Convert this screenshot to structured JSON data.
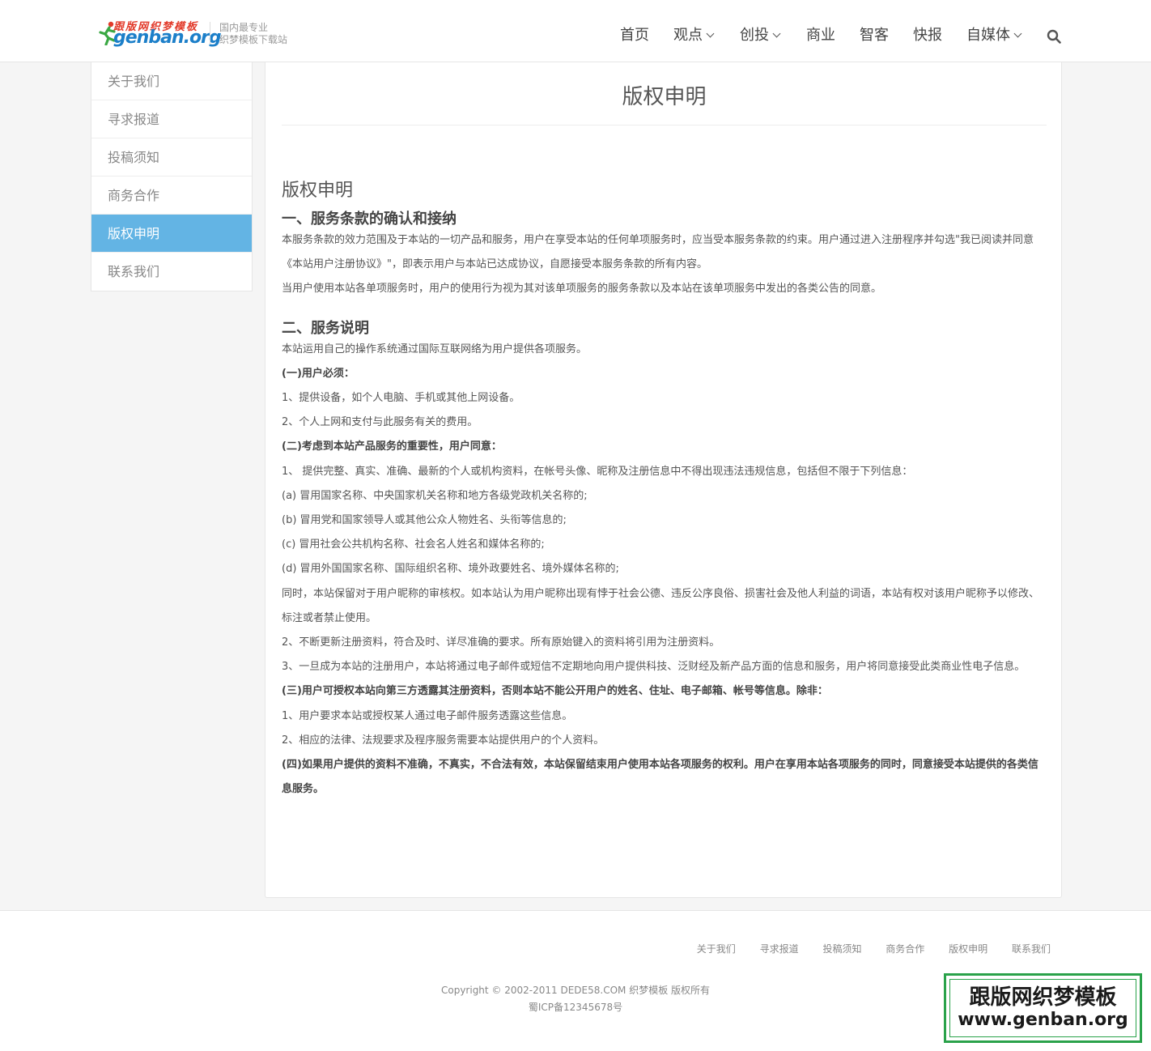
{
  "header": {
    "logo_top": "跟版网织梦模板",
    "logo_main": "genban.org",
    "slogan_line1": "国内最专业",
    "slogan_line2": "织梦模板下载站",
    "nav": [
      {
        "label": "首页",
        "dropdown": false
      },
      {
        "label": "观点",
        "dropdown": true
      },
      {
        "label": "创投",
        "dropdown": true
      },
      {
        "label": "商业",
        "dropdown": false
      },
      {
        "label": "智客",
        "dropdown": false
      },
      {
        "label": "快报",
        "dropdown": false
      },
      {
        "label": "自媒体",
        "dropdown": true
      }
    ]
  },
  "sidebar": {
    "items": [
      {
        "label": "关于我们"
      },
      {
        "label": "寻求报道"
      },
      {
        "label": "投稿须知"
      },
      {
        "label": "商务合作"
      },
      {
        "label": "版权申明"
      },
      {
        "label": "联系我们"
      }
    ],
    "active_index": 4,
    "active_color": "#63b4e4"
  },
  "article": {
    "title": "版权申明",
    "heading": "版权申明",
    "section1_title": "一、服务条款的确认和接纳",
    "section1_p1": "本服务条款的效力范围及于本站的一切产品和服务，用户在享受本站的任何单项服务时，应当受本服务条款的约束。用户通过进入注册程序并勾选\"我已阅读并同意《本站用户注册协议》\"，即表示用户与本站已达成协议，自愿接受本服务条款的所有内容。",
    "section1_p2": "当用户使用本站各单项服务时，用户的使用行为视为其对该单项服务的服务条款以及本站在该单项服务中发出的各类公告的同意。",
    "section2_title": "二、服务说明",
    "section2_intro": "本站运用自己的操作系统通过国际互联网络为用户提供各项服务。",
    "sub1_title": "(一)用户必须：",
    "sub1_p1": "1、提供设备，如个人电脑、手机或其他上网设备。",
    "sub1_p2": "2、个人上网和支付与此服务有关的费用。",
    "sub2_title": "(二)考虑到本站产品服务的重要性，用户同意：",
    "sub2_p1": "1、 提供完整、真实、准确、最新的个人或机构资料，在帐号头像、昵称及注册信息中不得出现违法违规信息，包括但不限于下列信息：",
    "sub2_a": "(a) 冒用国家名称、中央国家机关名称和地方各级党政机关名称的;",
    "sub2_b": "(b) 冒用党和国家领导人或其他公众人物姓名、头衔等信息的;",
    "sub2_c": "(c) 冒用社会公共机构名称、社会名人姓名和媒体名称的;",
    "sub2_d": "(d) 冒用外国国家名称、国际组织名称、境外政要姓名、境外媒体名称的;",
    "sub2_p2": "同时，本站保留对于用户昵称的审核权。如本站认为用户昵称出现有悖于社会公德、违反公序良俗、损害社会及他人利益的词语，本站有权对该用户昵称予以修改、标注或者禁止使用。",
    "sub2_p3": "2、不断更新注册资料，符合及时、详尽准确的要求。所有原始键入的资料将引用为注册资料。",
    "sub2_p4": "3、一旦成为本站的注册用户，本站将通过电子邮件或短信不定期地向用户提供科技、泛财经及新产品方面的信息和服务，用户将同意接受此类商业性电子信息。",
    "sub3_title": "(三)用户可授权本站向第三方透露其注册资料，否则本站不能公开用户的姓名、住址、电子邮箱、帐号等信息。除非：",
    "sub3_p1": "1、用户要求本站或授权某人通过电子邮件服务透露这些信息。",
    "sub3_p2": "2、相应的法律、法规要求及程序服务需要本站提供用户的个人资料。",
    "sub4_title": "(四)如果用户提供的资料不准确，不真实，不合法有效，本站保留结束用户使用本站各项服务的权利。用户在享用本站各项服务的同时，同意接受本站提供的各类信息服务。"
  },
  "footer": {
    "links": [
      {
        "label": "关于我们"
      },
      {
        "label": "寻求报道"
      },
      {
        "label": "投稿须知"
      },
      {
        "label": "商务合作"
      },
      {
        "label": "版权申明"
      },
      {
        "label": "联系我们"
      }
    ],
    "copyright": "Copyright © 2002-2011 DEDE58.COM 织梦模板 版权所有",
    "icp": "蜀ICP备12345678号"
  },
  "watermark": {
    "line1": "跟版网织梦模板",
    "line2": "www.genban.org",
    "border_color": "#2aa24a"
  }
}
